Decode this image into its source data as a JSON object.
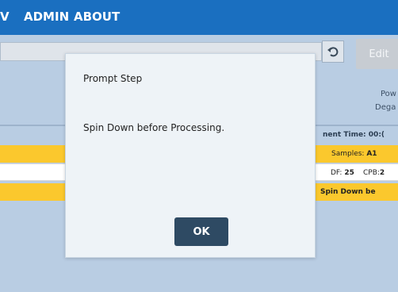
{
  "nav": {
    "items": [
      {
        "label": "V"
      },
      {
        "label": "ADMIN"
      },
      {
        "label": "ABOUT"
      }
    ]
  },
  "toolbar": {
    "edit_label": "Edit",
    "undo_icon": "undo-icon"
  },
  "status": {
    "pow_label": "Pow",
    "deg_label": "Dega",
    "time_label": "nent Time: 00:("
  },
  "rows": {
    "samples_label": "Samples:",
    "samples_value": "A1",
    "df_label": "DF:",
    "df_value": "25",
    "cpb_label": "CPB:",
    "cpb_value": "2",
    "prompt_text": "Spin Down be"
  },
  "dialog": {
    "title": "Prompt Step",
    "message": "Spin Down before Processing.",
    "ok_label": "OK"
  },
  "colors": {
    "nav_bg": "#1a6fc0",
    "highlight": "#fbc82d",
    "ok_button": "#2e4a63"
  }
}
